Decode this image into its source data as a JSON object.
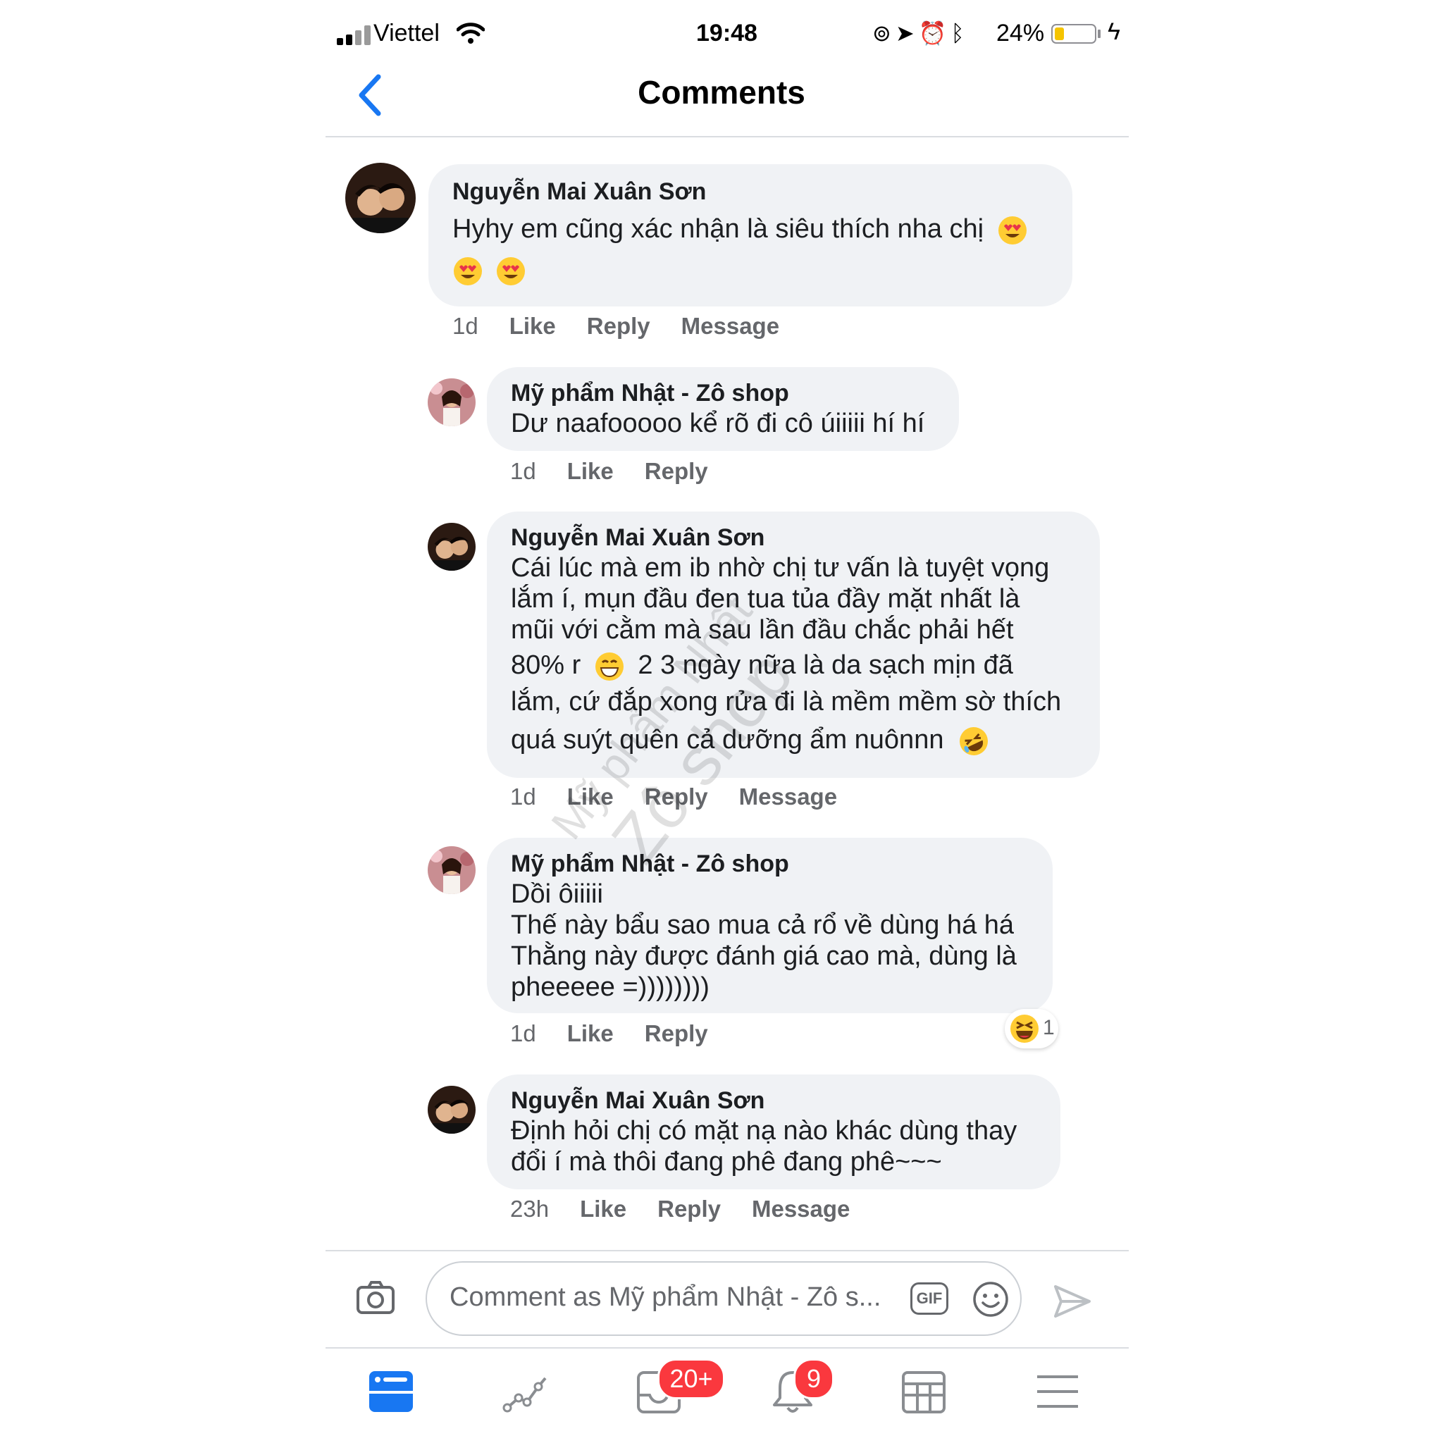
{
  "status_bar": {
    "carrier": "Viettel",
    "time": "19:48",
    "battery_percent": "24%",
    "battery_level": 0.24,
    "icons": [
      "signal-icon",
      "wifi-icon",
      "rotation-lock-icon",
      "location-icon",
      "alarm-icon",
      "bluetooth-icon",
      "battery-icon",
      "charging-icon"
    ]
  },
  "header": {
    "title": "Comments",
    "back_icon": "chevron-left-icon"
  },
  "comments": [
    {
      "author": "Nguyễn Mai Xuân Sơn",
      "lines": [
        "Hyhy em cũng xác nhận là siêu thích nha chị"
      ],
      "emojis": [
        "heart-eyes",
        "heart-eyes",
        "heart-eyes"
      ],
      "time": "1d",
      "like": "Like",
      "reply": "Reply",
      "message": "Message"
    },
    {
      "author": "Mỹ phẩm Nhật - Zô shop",
      "lines": [
        "Dư naafooooo kể rõ đi cô úiiiii hí hí"
      ],
      "time": "1d",
      "like": "Like",
      "reply": "Reply"
    },
    {
      "author": "Nguyễn Mai Xuân Sơn",
      "lines": [
        "Cái lúc mà em ib nhờ chị tư vấn là tuyệt vọng",
        "lắm í, mụn đầu đen tua tủa đầy mặt nhất là",
        "mũi với cằm mà sau lần đầu chắc phải hết",
        "80% r",
        "2 3 ngày nữa là da sạch mịn đã",
        "lắm, cứ đắp xong rửa đi là mềm mềm sờ thích",
        "quá suýt quên cả dưỡng ẩm nuônnn"
      ],
      "emojis": [
        "grinning",
        "rofl"
      ],
      "time": "1d",
      "like": "Like",
      "reply": "Reply",
      "message": "Message"
    },
    {
      "author": "Mỹ phẩm Nhật - Zô shop",
      "lines": [
        "Dồi ôiiiii",
        "Thế này bẩu sao mua cả rổ về dùng há há",
        "Thằng này được đánh giá cao mà, dùng là",
        "pheeeee =))))))))"
      ],
      "time": "1d",
      "like": "Like",
      "reply": "Reply",
      "reaction": {
        "icon": "laughing-emoji",
        "count": "1"
      }
    },
    {
      "author": "Nguyễn Mai Xuân Sơn",
      "lines": [
        "Định hỏi chị có mặt nạ nào khác dùng thay",
        "đổi í mà thôi đang phê đang phê~~~"
      ],
      "time": "23h",
      "like": "Like",
      "reply": "Reply",
      "message": "Message"
    }
  ],
  "watermark": {
    "line1": "Mỹ phẩm Nhật",
    "line2": "Zô shop"
  },
  "composer": {
    "placeholder": "Comment as Mỹ phẩm Nhật - Zô s...",
    "gif_label": "GIF",
    "camera_icon": "camera-icon",
    "emoji_icon": "smiley-icon",
    "send_icon": "send-icon"
  },
  "tab_bar": {
    "tabs": [
      {
        "icon": "news-feed-icon",
        "active": true
      },
      {
        "icon": "insights-icon"
      },
      {
        "icon": "inbox-icon",
        "badge": "20+"
      },
      {
        "icon": "notifications-icon",
        "badge": "9"
      },
      {
        "icon": "calendar-grid-icon"
      },
      {
        "icon": "menu-icon"
      }
    ]
  },
  "colors": {
    "accent": "#1877f2",
    "bubble": "#f0f2f5",
    "meta_text": "#65676b",
    "badge": "#fa383e"
  }
}
